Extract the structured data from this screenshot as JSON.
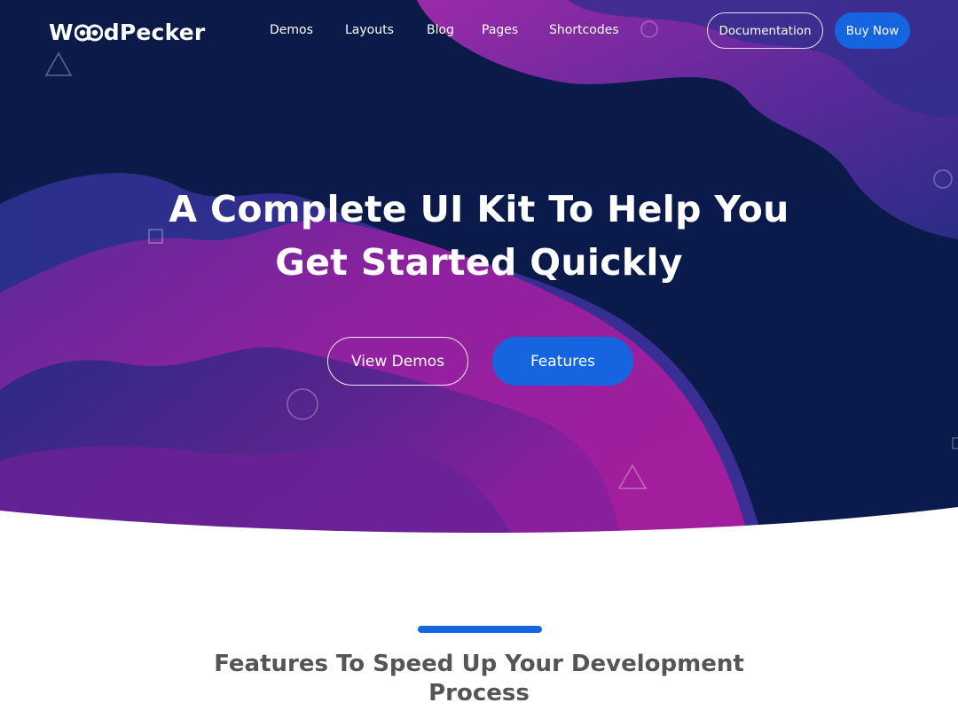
{
  "header": {
    "logo": {
      "text_before": "W",
      "text_after": "dPecker",
      "full": "WoodPecker"
    },
    "nav": [
      {
        "label": "Demos"
      },
      {
        "label": "Layouts"
      },
      {
        "label": "Blog"
      },
      {
        "label": "Pages"
      },
      {
        "label": "Shortcodes"
      }
    ],
    "documentation_label": "Documentation",
    "buy_label": "Buy Now"
  },
  "hero": {
    "headline_line1": "A Complete UI Kit To Help You",
    "headline_line2": "Get Started Quickly",
    "view_demos_label": "View Demos",
    "features_label": "Features",
    "decorative_icons": [
      "triangle-outline-icon",
      "square-outline-icon",
      "circle-outline-icon"
    ]
  },
  "features_section": {
    "title": "Features To Speed Up Your Development Process"
  },
  "colors": {
    "hero_dark": "#0c1b4a",
    "hero_purple": "#8a1f9e",
    "accent_blue": "#1565e0",
    "heading_gray": "#555555"
  }
}
